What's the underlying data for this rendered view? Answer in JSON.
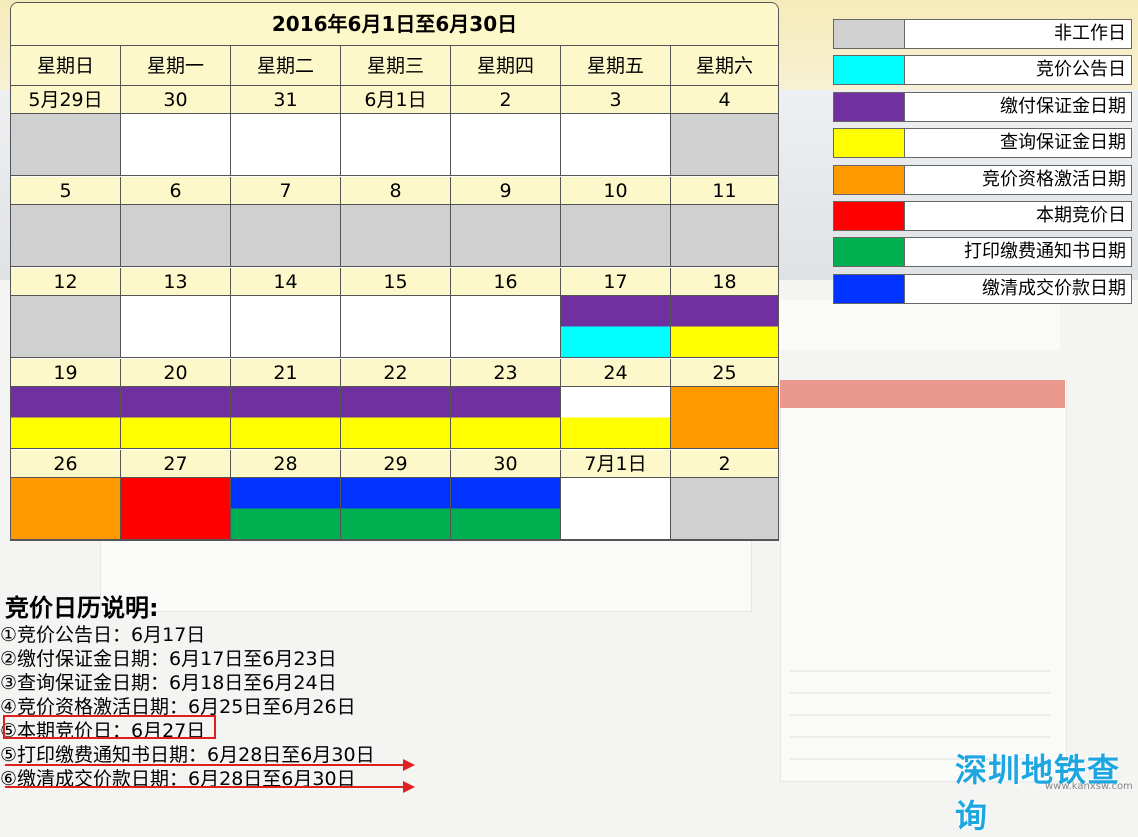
{
  "calendar": {
    "title": "2016年6月1日至6月30日",
    "weekdays": [
      "星期日",
      "星期一",
      "星期二",
      "星期三",
      "星期四",
      "星期五",
      "星期六"
    ],
    "weeks": [
      [
        "5月29日",
        "30",
        "31",
        "6月1日",
        "2",
        "3",
        "4"
      ],
      [
        "5",
        "6",
        "7",
        "8",
        "9",
        "10",
        "11"
      ],
      [
        "12",
        "13",
        "14",
        "15",
        "16",
        "17",
        "18"
      ],
      [
        "19",
        "20",
        "21",
        "22",
        "23",
        "24",
        "25"
      ],
      [
        "26",
        "27",
        "28",
        "29",
        "30",
        "7月1日",
        "2"
      ]
    ]
  },
  "colors": {
    "non_working": "#d0d0d0",
    "announcement": "#00ffff",
    "deposit": "#7030a0",
    "query_deposit": "#ffff00",
    "activation": "#ff9900",
    "auction": "#ff0000",
    "print_notice": "#00b050",
    "payment": "#0033ff"
  },
  "legend": [
    {
      "label": "非工作日",
      "color": "#d0d0d0"
    },
    {
      "label": "竞价公告日",
      "color": "#00ffff"
    },
    {
      "label": "缴付保证金日期",
      "color": "#7030a0"
    },
    {
      "label": "查询保证金日期",
      "color": "#ffff00"
    },
    {
      "label": "竞价资格激活日期",
      "color": "#ff9900"
    },
    {
      "label": "本期竞价日",
      "color": "#ff0000"
    },
    {
      "label": "打印缴费通知书日期",
      "color": "#00b050"
    },
    {
      "label": "缴清成交价款日期",
      "color": "#0033ff"
    }
  ],
  "explanation": {
    "title": "竞价日历说明:",
    "lines": [
      "①竞价公告日：6月17日",
      "②缴付保证金日期：6月17日至6月23日",
      "③查询保证金日期：6月18日至6月24日",
      "④竞价资格激活日期：6月25日至6月26日",
      "⑤本期竞价日：6月27日",
      "⑤打印缴费通知书日期：6月28日至6月30日",
      "⑥缴清成交价款日期：6月28日至6月30日"
    ]
  },
  "watermark": {
    "text": "深圳地铁查询",
    "url_text": "www.kanxsw.com"
  }
}
